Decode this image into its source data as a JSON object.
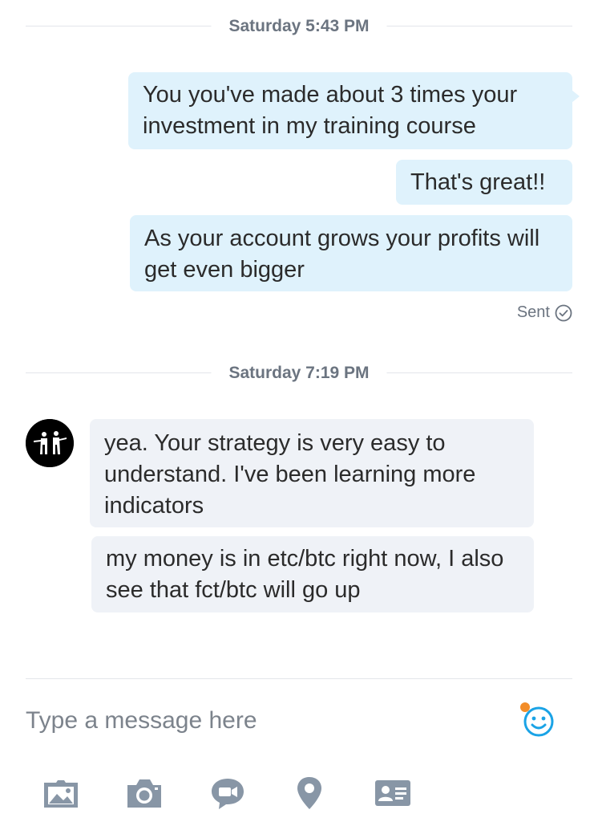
{
  "conversation": {
    "groups": [
      {
        "timestamp": "Saturday 5:43 PM",
        "messages": [
          {
            "direction": "outgoing",
            "text": "You you've made about 3 times your investment in my training course"
          },
          {
            "direction": "outgoing",
            "text": "That's great!!"
          },
          {
            "direction": "outgoing",
            "text": "As your account grows your profits will get even bigger"
          }
        ],
        "status": "Sent"
      },
      {
        "timestamp": "Saturday 7:19 PM",
        "messages": [
          {
            "direction": "incoming",
            "text": "yea. Your strategy is very easy to understand. I've been learning more indicators"
          },
          {
            "direction": "incoming",
            "text": "my money is in etc/btc right now, I also see that fct/btc will go up"
          }
        ]
      }
    ]
  },
  "composer": {
    "placeholder": "Type a message here",
    "emoji_icon": "smiley-icon",
    "toolbar": [
      "image-icon",
      "camera-icon",
      "video-message-icon",
      "location-icon",
      "contact-card-icon"
    ]
  },
  "colors": {
    "outgoing_bubble": "#dff2fc",
    "incoming_bubble": "#eff2f7",
    "accent": "#1aa3e6",
    "notification_dot": "#f28c28",
    "icon_gray": "#8896a6"
  }
}
